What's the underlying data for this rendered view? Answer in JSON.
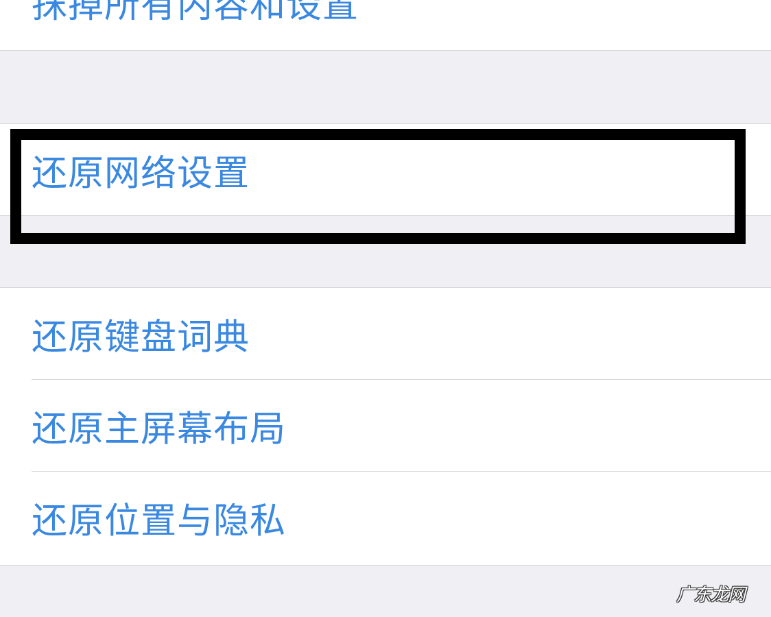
{
  "settings": {
    "erase_all": "抹掉所有内容和设置",
    "reset_network": "还原网络设置",
    "reset_keyboard": "还原键盘词典",
    "reset_home_screen": "还原主屏幕布局",
    "reset_location_privacy": "还原位置与隐私"
  },
  "watermark": "广东龙网",
  "colors": {
    "link_blue": "#3a88e0",
    "background": "#efeff4",
    "cell_background": "#ffffff",
    "highlight_border": "#000000"
  }
}
